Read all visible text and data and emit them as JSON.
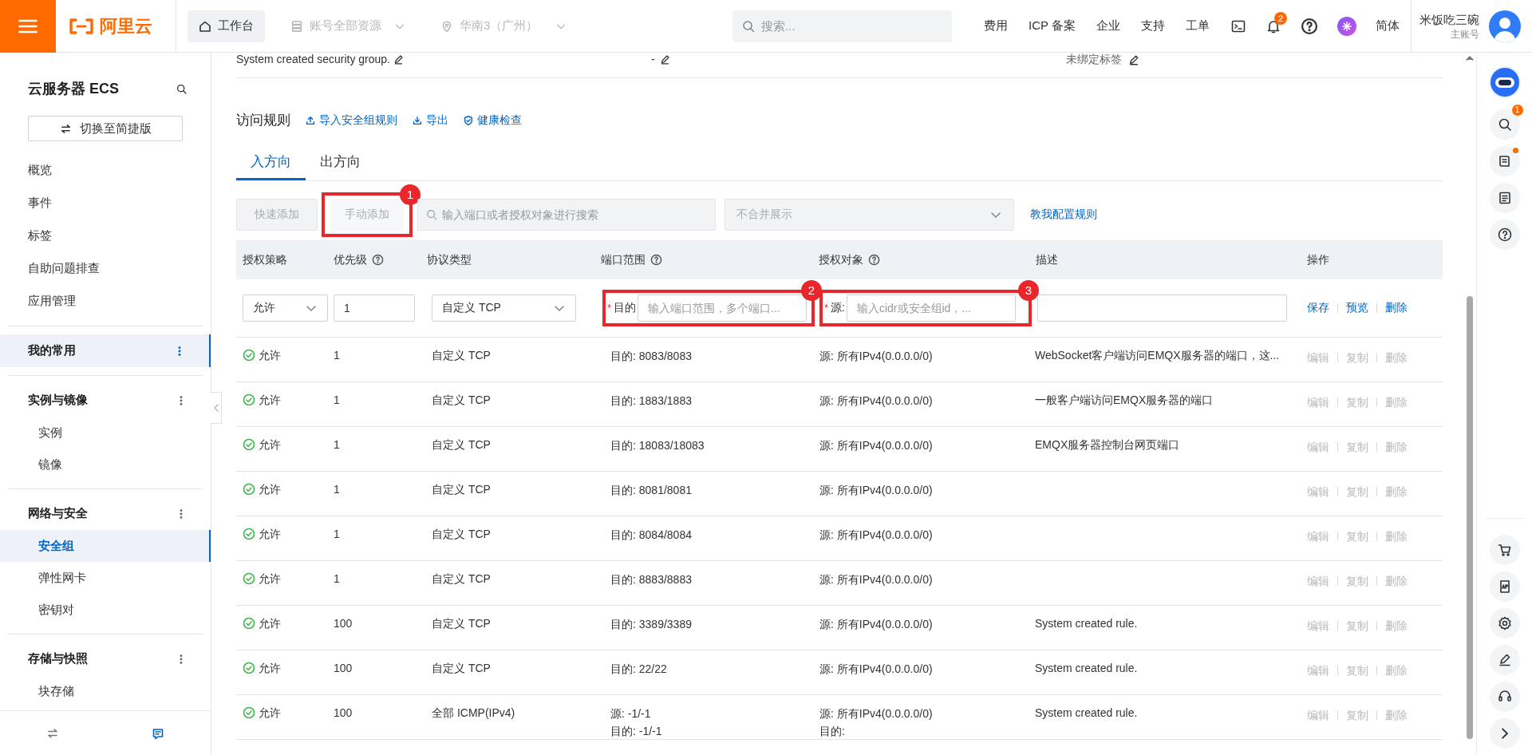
{
  "top_bar": {
    "logo": "阿里云",
    "workbench": "工作台",
    "account_scope": "账号全部资源",
    "region": "华南3（广州）",
    "search_placeholder": "搜索...",
    "links": [
      "费用",
      "ICP 备案",
      "企业",
      "支持",
      "工单"
    ],
    "notification_count": "2",
    "language": "简体",
    "user_name": "米饭吃三碗",
    "account_type": "主账号"
  },
  "sidebar": {
    "title": "云服务器 ECS",
    "switch_button": "切换至简捷版",
    "items": [
      {
        "label": "概览",
        "kind": "link",
        "selected": false
      },
      {
        "label": "事件",
        "kind": "link",
        "selected": false
      },
      {
        "label": "标签",
        "kind": "link",
        "selected": false
      },
      {
        "label": "自助问题排查",
        "kind": "link",
        "selected": false
      },
      {
        "label": "应用管理",
        "kind": "link",
        "selected": false
      },
      {
        "label": "我的常用",
        "kind": "group",
        "selected": true
      },
      {
        "label": "实例与镜像",
        "kind": "group",
        "selected": false,
        "children": [
          {
            "label": "实例",
            "selected": false
          },
          {
            "label": "镜像",
            "selected": false
          }
        ]
      },
      {
        "label": "网络与安全",
        "kind": "group",
        "selected": false,
        "children": [
          {
            "label": "安全组",
            "selected": true
          },
          {
            "label": "弹性网卡",
            "selected": false
          },
          {
            "label": "密钥对",
            "selected": false
          }
        ]
      },
      {
        "label": "存储与快照",
        "kind": "group",
        "selected": false,
        "children": [
          {
            "label": "块存储",
            "selected": false
          }
        ]
      }
    ]
  },
  "group_info": {
    "description": "System created security group.",
    "column_2": "-",
    "tags": "未绑定标签"
  },
  "rules": {
    "title": "访问规则",
    "actions": [
      {
        "kind": "import",
        "label": "导入安全组规则"
      },
      {
        "kind": "export",
        "label": "导出"
      },
      {
        "kind": "check",
        "label": "健康检查"
      }
    ],
    "tabs": [
      {
        "label": "入方向",
        "selected": true
      },
      {
        "label": "出方向",
        "selected": false
      }
    ],
    "toolbar": {
      "quick_add": "快速添加",
      "manual_add": {
        "label": "手动添加",
        "marker": "1"
      },
      "search_placeholder": "输入端口或者授权对象进行搜索",
      "merge_select": "不合并展示",
      "help_link": "教我配置规则"
    },
    "columns": [
      {
        "label": "授权策略",
        "help": false
      },
      {
        "label": "优先级",
        "help": true
      },
      {
        "label": "协议类型",
        "help": false
      },
      {
        "label": "端口范围",
        "help": true
      },
      {
        "label": "授权对象",
        "help": true
      },
      {
        "label": "描述",
        "help": false
      },
      {
        "label": "操作",
        "help": false
      }
    ],
    "new_rule": {
      "policy": "允许",
      "priority": "1",
      "protocol": "自定义 TCP",
      "port_required": "*",
      "port_label": "目的",
      "port_placeholder": "输入端口范围，多个端口...",
      "port_marker": "2",
      "source_required": "*",
      "source_label": "源:",
      "source_placeholder": "输入cidr或安全组id，...",
      "source_marker": "3",
      "actions": [
        "保存",
        "预览",
        "删除"
      ]
    },
    "rows": [
      {
        "policy": "允许",
        "priority": "1",
        "protocol": "自定义 TCP",
        "port": [
          "目的: 8083/8083"
        ],
        "source": [
          "源: 所有IPv4(0.0.0.0/0)"
        ],
        "description": "WebSocket客户端访问EMQX服务器的端口，这...",
        "actions": [
          "编辑",
          "复制",
          "删除"
        ],
        "actions_disabled": true
      },
      {
        "policy": "允许",
        "priority": "1",
        "protocol": "自定义 TCP",
        "port": [
          "目的: 1883/1883"
        ],
        "source": [
          "源: 所有IPv4(0.0.0.0/0)"
        ],
        "description": "一般客户端访问EMQX服务器的端口",
        "actions": [
          "编辑",
          "复制",
          "删除"
        ],
        "actions_disabled": true
      },
      {
        "policy": "允许",
        "priority": "1",
        "protocol": "自定义 TCP",
        "port": [
          "目的: 18083/18083"
        ],
        "source": [
          "源: 所有IPv4(0.0.0.0/0)"
        ],
        "description": "EMQX服务器控制台网页端口",
        "actions": [
          "编辑",
          "复制",
          "删除"
        ],
        "actions_disabled": true
      },
      {
        "policy": "允许",
        "priority": "1",
        "protocol": "自定义 TCP",
        "port": [
          "目的: 8081/8081"
        ],
        "source": [
          "源: 所有IPv4(0.0.0.0/0)"
        ],
        "actions": [
          "编辑",
          "复制",
          "删除"
        ],
        "actions_disabled": true
      },
      {
        "policy": "允许",
        "priority": "1",
        "protocol": "自定义 TCP",
        "port": [
          "目的: 8084/8084"
        ],
        "source": [
          "源: 所有IPv4(0.0.0.0/0)"
        ],
        "actions": [
          "编辑",
          "复制",
          "删除"
        ],
        "actions_disabled": true
      },
      {
        "policy": "允许",
        "priority": "1",
        "protocol": "自定义 TCP",
        "port": [
          "目的: 8883/8883"
        ],
        "source": [
          "源: 所有IPv4(0.0.0.0/0)"
        ],
        "actions": [
          "编辑",
          "复制",
          "删除"
        ],
        "actions_disabled": true
      },
      {
        "policy": "允许",
        "priority": "100",
        "protocol": "自定义 TCP",
        "port": [
          "目的: 3389/3389"
        ],
        "source": [
          "源: 所有IPv4(0.0.0.0/0)"
        ],
        "description": "System created rule.",
        "actions": [
          "编辑",
          "复制",
          "删除"
        ],
        "actions_disabled": true
      },
      {
        "policy": "允许",
        "priority": "100",
        "protocol": "自定义 TCP",
        "port": [
          "目的: 22/22"
        ],
        "source": [
          "源: 所有IPv4(0.0.0.0/0)"
        ],
        "description": "System created rule.",
        "actions": [
          "编辑",
          "复制",
          "删除"
        ],
        "actions_disabled": true
      },
      {
        "policy": "允许",
        "priority": "100",
        "protocol": "全部 ICMP(IPv4)",
        "port": [
          "源: -1/-1",
          "目的: -1/-1"
        ],
        "source": [
          "源: 所有IPv4(0.0.0.0/0)",
          "目的:"
        ],
        "description": "System created rule.",
        "actions": [
          "编辑",
          "复制",
          "删除"
        ],
        "actions_disabled": true
      }
    ]
  },
  "right_rail": {
    "search_badge": "1"
  }
}
